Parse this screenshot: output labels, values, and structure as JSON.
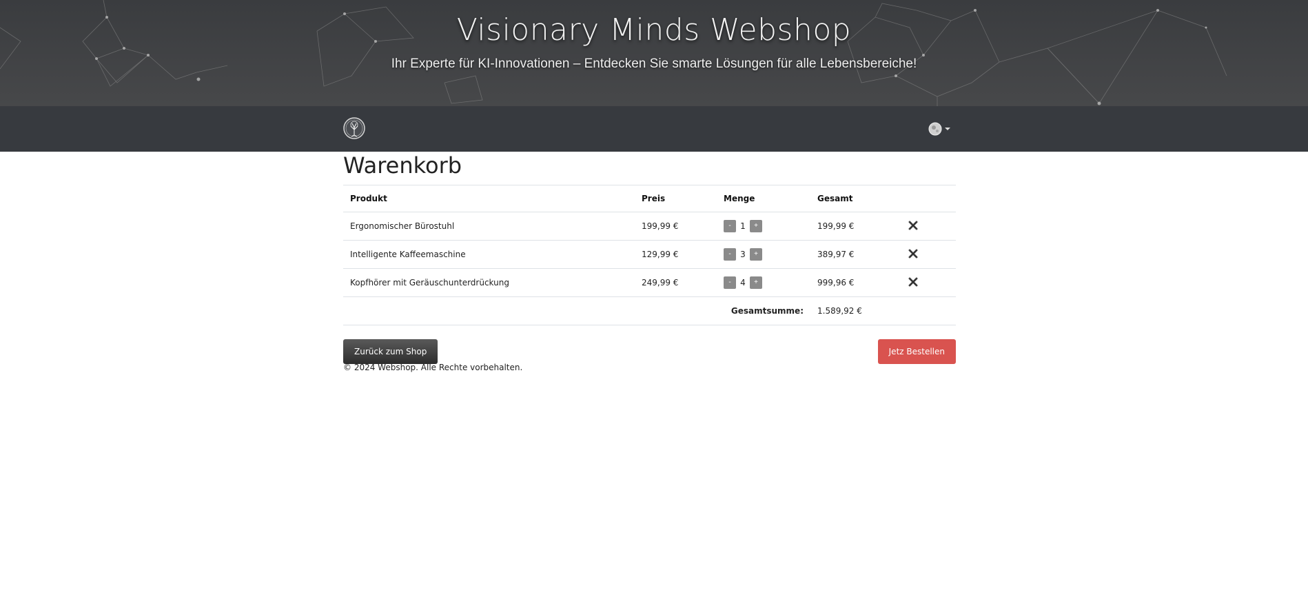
{
  "header": {
    "title": "Visionary Minds Webshop",
    "subtitle": "Ihr Experte für KI-Innovationen – Entdecken Sie smarte Lösungen für alle Lebensbereiche!"
  },
  "navbar": {
    "logo_icon": "tree-of-life-logo-icon",
    "language_icon": "globe-flag-icon"
  },
  "cart": {
    "title": "Warenkorb",
    "columns": [
      "Produkt",
      "Preis",
      "Menge",
      "Gesamt"
    ],
    "items": [
      {
        "product": "Ergonomischer Bürostuhl",
        "price": "199,99 €",
        "quantity": "1",
        "total": "199,99 €"
      },
      {
        "product": "Intelligente Kaffeemaschine",
        "price": "129,99 €",
        "quantity": "3",
        "total": "389,97 €"
      },
      {
        "product": "Kopfhörer mit Geräuschunterdrückung",
        "price": "249,99 €",
        "quantity": "4",
        "total": "999,96 €"
      }
    ],
    "minus_label": "-",
    "plus_label": "+",
    "remove_icon": "close-x-icon",
    "sum_label": "Gesamtsumme:",
    "sum_value": "1.589,92 €"
  },
  "actions": {
    "back_label": "Zurück zum Shop",
    "order_label": "Jetz Bestellen"
  },
  "footer": {
    "copyright": "© 2024 Webshop. Alle Rechte vorbehalten."
  },
  "colors": {
    "header_bg": "#3e3f41",
    "navbar_bg": "#373a3f",
    "order_button": "#d9534f",
    "back_button": "#3a3a3a",
    "qty_button": "#8a8a8a"
  }
}
